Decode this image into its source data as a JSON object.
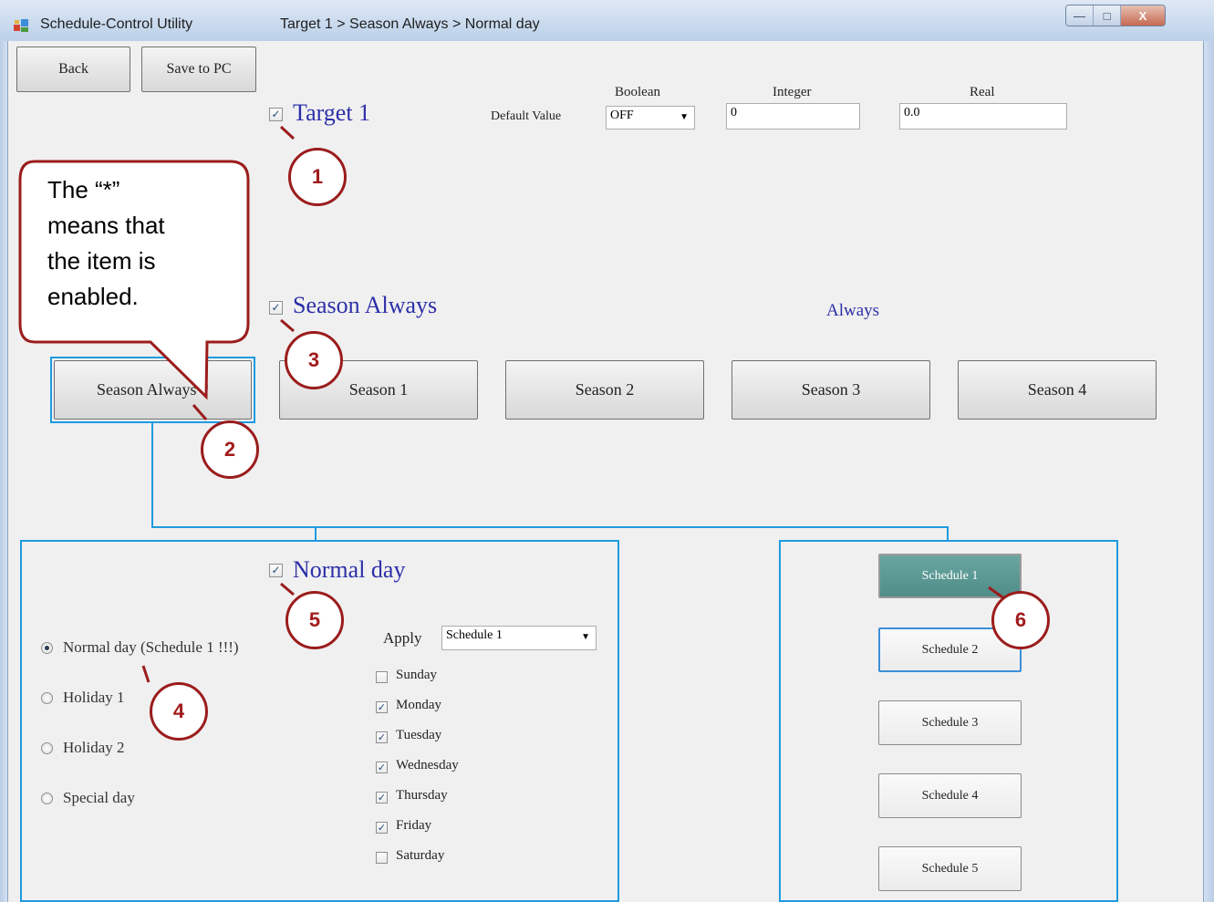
{
  "window": {
    "title": "Schedule-Control Utility",
    "breadcrumb": "Target 1 > Season Always > Normal day",
    "controls": {
      "minimize": "—",
      "maximize": "□",
      "close": "X"
    }
  },
  "toolbar": {
    "back_label": "Back",
    "save_label": "Save to PC"
  },
  "target": {
    "label": "Target 1",
    "checked": true,
    "default_value_label": "Default Value",
    "boolean_label": "Boolean",
    "boolean_value": "OFF",
    "integer_label": "Integer",
    "integer_value": "0",
    "real_label": "Real",
    "real_value": "0.0"
  },
  "season": {
    "label": "Season Always",
    "checked": true,
    "mode_text": "Always",
    "buttons": [
      "Season Always *",
      "Season 1",
      "Season 2",
      "Season 3",
      "Season 4"
    ]
  },
  "day": {
    "label": "Normal day",
    "checked": true,
    "apply_label": "Apply",
    "apply_value": "Schedule 1",
    "types": [
      {
        "label": "Normal day (Schedule 1 !!!)",
        "selected": true
      },
      {
        "label": "Holiday 1",
        "selected": false
      },
      {
        "label": "Holiday 2",
        "selected": false
      },
      {
        "label": "Special day",
        "selected": false
      }
    ],
    "weekdays": [
      {
        "label": "Sunday",
        "checked": false
      },
      {
        "label": "Monday",
        "checked": true
      },
      {
        "label": "Tuesday",
        "checked": true
      },
      {
        "label": "Wednesday",
        "checked": true
      },
      {
        "label": "Thursday",
        "checked": true
      },
      {
        "label": "Friday",
        "checked": true
      },
      {
        "label": "Saturday",
        "checked": false
      }
    ]
  },
  "schedules": [
    "Schedule 1",
    "Schedule 2",
    "Schedule 3",
    "Schedule 4",
    "Schedule 5"
  ],
  "callout": {
    "line1": "The  “*”",
    "line2": "means that",
    "line3": "the item is",
    "line4": "enabled."
  },
  "markers": [
    "1",
    "2",
    "3",
    "4",
    "5",
    "6"
  ],
  "colors": {
    "accent": "#1e9be0",
    "marker": "#9b1c1c",
    "heading": "#2c2fa8",
    "active_schedule": "#5a9894"
  }
}
